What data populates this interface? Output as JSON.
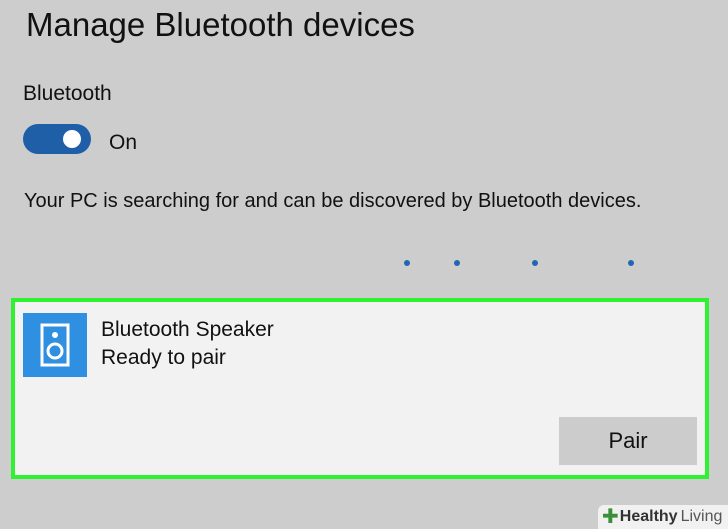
{
  "header": {
    "title": "Manage Bluetooth devices"
  },
  "bluetooth": {
    "label": "Bluetooth",
    "toggle_on": true,
    "toggle_state": "On",
    "status_text": "Your PC is searching for and can be discovered by Bluetooth devices."
  },
  "device": {
    "name": "Bluetooth Speaker",
    "status": "Ready to pair",
    "icon": "speaker-icon",
    "pair_label": "Pair"
  },
  "watermark": {
    "brand_bold": "Healthy",
    "brand_light": "Living"
  },
  "colors": {
    "background": "#cdcdcd",
    "toggle_accent": "#1f5fa7",
    "card_highlight": "#2ff031",
    "device_icon_bg": "#2f8fe0",
    "pair_button_bg": "#cccccc"
  }
}
